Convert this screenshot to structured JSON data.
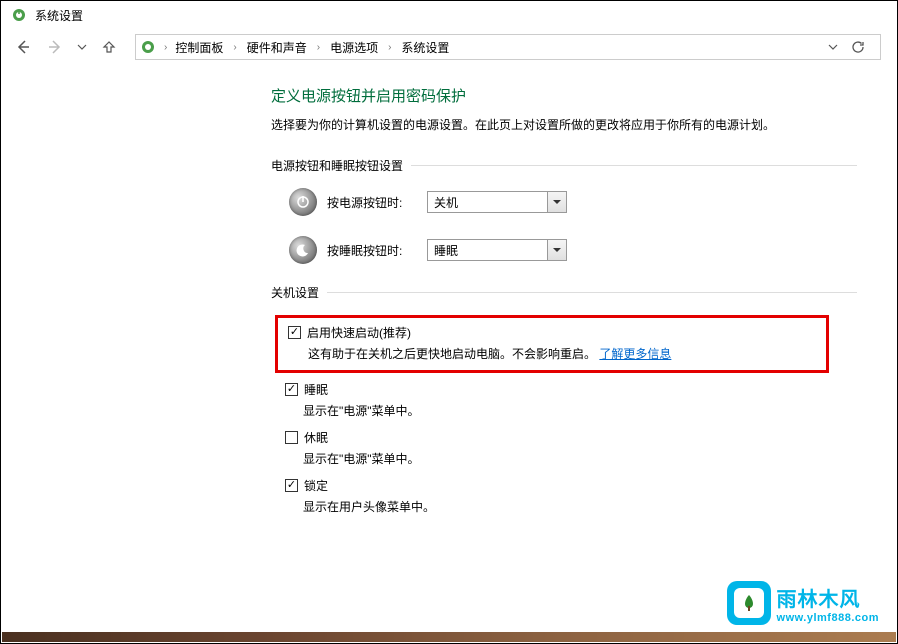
{
  "window_title": "系统设置",
  "breadcrumb": {
    "items": [
      "控制面板",
      "硬件和声音",
      "电源选项",
      "系统设置"
    ]
  },
  "page": {
    "title": "定义电源按钮并启用密码保护",
    "description": "选择要为你的计算机设置的电源设置。在此页上对设置所做的更改将应用于你所有的电源计划。"
  },
  "button_section": {
    "header": "电源按钮和睡眠按钮设置",
    "power_button": {
      "label": "按电源按钮时:",
      "value": "关机"
    },
    "sleep_button": {
      "label": "按睡眠按钮时:",
      "value": "睡眠"
    }
  },
  "shutdown_section": {
    "header": "关机设置",
    "fast_startup": {
      "label": "启用快速启动(推荐)",
      "checked": true,
      "description": "这有助于在关机之后更快地启动电脑。不会影响重启。",
      "link_text": "了解更多信息"
    },
    "sleep": {
      "label": "睡眠",
      "checked": true,
      "description": "显示在\"电源\"菜单中。"
    },
    "hibernate": {
      "label": "休眠",
      "checked": false,
      "description": "显示在\"电源\"菜单中。"
    },
    "lock": {
      "label": "锁定",
      "checked": true,
      "description": "显示在用户头像菜单中。"
    }
  },
  "watermark": {
    "brand": "雨林木风",
    "url": "www.ylmf888.com"
  }
}
